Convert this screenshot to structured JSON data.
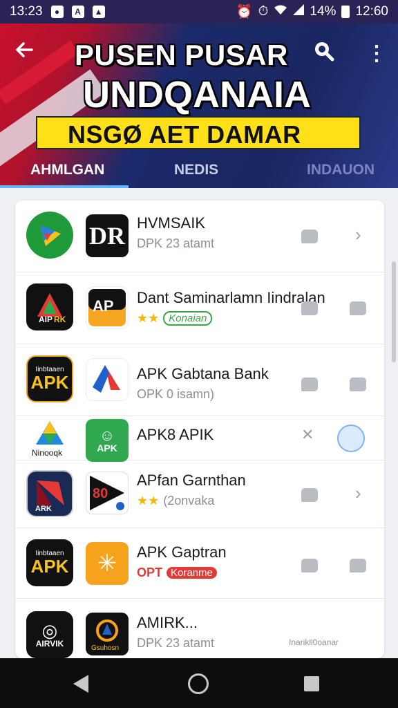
{
  "status_bar": {
    "time": "13:23",
    "battery": "14%",
    "clock_right": "12:60",
    "icons": [
      "notification-icon",
      "a-icon",
      "photo-icon",
      "alarm-icon",
      "timer-icon",
      "wifi-icon",
      "signal-icon",
      "battery-icon"
    ]
  },
  "header": {
    "title_line1": "PUSEN PUSAR",
    "title_line2": "UNDQANAIA",
    "banner_text": "NSGØ AET DAMAR",
    "tabs": [
      {
        "label": "AHMLGAN",
        "active": true
      },
      {
        "label": "NEDIS",
        "active": false
      },
      {
        "label": "INDAUON",
        "active": false
      }
    ],
    "accent_color": "#5fb8ff"
  },
  "list": {
    "items": [
      {
        "name": "HVMSAIK",
        "sub": "DPK 23 atamt",
        "icon1": "green-play-icon",
        "icon2": "dr-logo-icon",
        "action": "chevron"
      },
      {
        "name": "Dant Saminarlamn Iindralan",
        "sub_stars": "★★",
        "badge": "Konaian",
        "icon1": "apk-dark-icon",
        "icon2": "ap-orange-icon",
        "action": "flag"
      },
      {
        "name": "APK Gabtana Bank",
        "sub": "OPK 0 isamn)",
        "icon1": "apk-black-badge-icon",
        "icon2": "blue-arrow-icon",
        "action": "flag"
      },
      {
        "name": "APK8 APIK",
        "icon1": "triangle-apk-icon",
        "icon2": "green-apk-icon",
        "action": "circle"
      },
      {
        "name": "APfan Garnthan",
        "sub_stars": "★★",
        "sub": "(2onvaka",
        "icon1": "red-apk-icon",
        "icon2": "play-80-icon",
        "action": "chevron"
      },
      {
        "name": "APK Gaptran",
        "sub_prefix": "OPT",
        "badge_red": "Koranme",
        "icon1": "apk-black-badge-icon",
        "icon2": "orange-star-icon",
        "action": "flag"
      },
      {
        "name": "AMIRK...",
        "sub": "DPK 23 atamt",
        "right_text": "Inarikll0oanar",
        "icon1": "camera-apk-icon",
        "icon2": "ring-logo-icon",
        "action": "text"
      }
    ]
  },
  "nav": {
    "buttons": [
      "back",
      "home",
      "recents"
    ]
  }
}
